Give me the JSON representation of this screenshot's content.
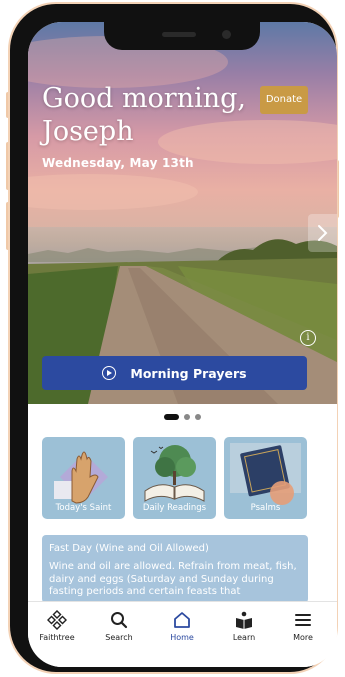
{
  "hero": {
    "greeting_line1": "Good morning,",
    "greeting_line2": "Joseph",
    "date": "Wednesday, May 13th",
    "donate_label": "Donate",
    "morning_prayers_label": "Morning Prayers"
  },
  "carousel": {
    "page_count": 3,
    "active_index": 0
  },
  "cards": [
    {
      "label": "Today's Saint"
    },
    {
      "label": "Daily Readings"
    },
    {
      "label": "Psalms"
    }
  ],
  "fast_day": {
    "title": "Fast Day (Wine and Oil Allowed)",
    "body": "Wine and oil are allowed. Refrain from meat, fish, dairy and eggs (Saturday and Sunday during fasting periods and certain feasts that"
  },
  "tabs": [
    {
      "label": "Faithtree",
      "icon": "faithtree-icon",
      "active": false
    },
    {
      "label": "Search",
      "icon": "search-icon",
      "active": false
    },
    {
      "label": "Home",
      "icon": "home-icon",
      "active": true
    },
    {
      "label": "Learn",
      "icon": "learn-icon",
      "active": false
    },
    {
      "label": "More",
      "icon": "menu-icon",
      "active": false
    }
  ],
  "colors": {
    "accent": "#2c4aa0",
    "donate": "#c99a45",
    "card": "#9cc0d6",
    "fast_card": "#a7c4dc"
  }
}
